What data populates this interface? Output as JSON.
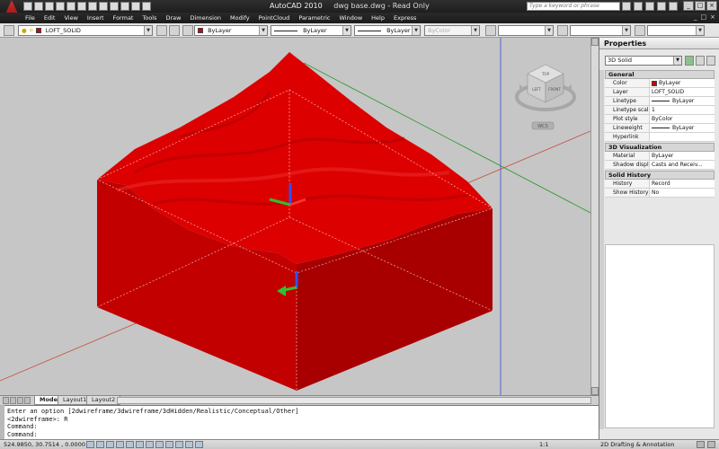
{
  "app": {
    "title": "AutoCAD 2010",
    "document": "dwg base.dwg - Read Only",
    "search_placeholder": "Type a keyword or phrase"
  },
  "menu": {
    "items": [
      "File",
      "Edit",
      "View",
      "Insert",
      "Format",
      "Tools",
      "Draw",
      "Dimension",
      "Modify",
      "PointCloud",
      "Parametric",
      "Window",
      "Help",
      "Express"
    ],
    "window_controls": [
      "_",
      "□",
      "×"
    ]
  },
  "toolbar": {
    "layer": "LOFT_SOLID",
    "color": "ByLayer",
    "linetype": "ByLayer",
    "lineweight": "ByLayer",
    "plotstyle": "ByColor",
    "layer_color": "#cc0000"
  },
  "viewport": {
    "viewcube_labels": {
      "top": "TOP",
      "left": "LEFT",
      "front": "FRONT"
    },
    "wcs_label": "WCS",
    "solid_color": "#dd0000"
  },
  "layout_tabs": [
    "Model",
    "Layout1",
    "Layout2"
  ],
  "command_line": {
    "lines": [
      "Enter an option [2dwireframe/3dwireframe/3dHidden/Realistic/Conceptual/Other]",
      "<2dwireframe>: R",
      "Command:",
      "Command:"
    ]
  },
  "status": {
    "coords": "524.9850, 30.7514 , 0.0000",
    "scale": "1:1",
    "workspace": "2D Drafting & Annotation"
  },
  "properties": {
    "title": "Properties",
    "selection": "3D Solid",
    "sections": [
      {
        "name": "General",
        "rows": [
          {
            "key": "Color",
            "value": "ByLayer",
            "swatch": "#cc0000"
          },
          {
            "key": "Layer",
            "value": "LOFT_SOLID"
          },
          {
            "key": "Linetype",
            "value": "ByLayer",
            "line": true
          },
          {
            "key": "Linetype scale",
            "value": "1"
          },
          {
            "key": "Plot style",
            "value": "ByColor"
          },
          {
            "key": "Lineweight",
            "value": "ByLayer",
            "line": true
          },
          {
            "key": "Hyperlink",
            "value": ""
          }
        ]
      },
      {
        "name": "3D Visualization",
        "rows": [
          {
            "key": "Material",
            "value": "ByLayer"
          },
          {
            "key": "Shadow display",
            "value": "Casts and Receiv..."
          }
        ]
      },
      {
        "name": "Solid History",
        "rows": [
          {
            "key": "History",
            "value": "Record"
          },
          {
            "key": "Show History",
            "value": "No"
          }
        ]
      }
    ]
  }
}
